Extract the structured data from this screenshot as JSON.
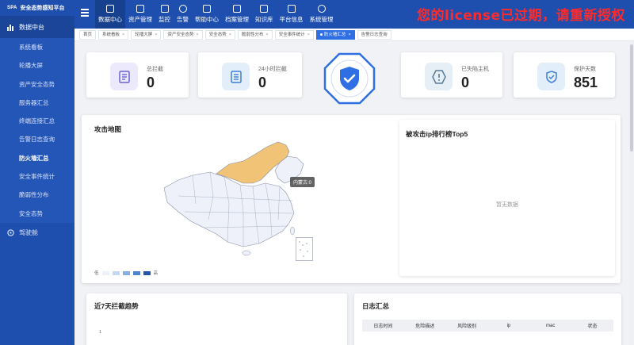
{
  "app": {
    "title": "安全态势感知平台",
    "logo_text": "SPA"
  },
  "license_warning": "您的license已过期，请重新授权",
  "sidebar": {
    "section": "数据中台",
    "items": [
      {
        "label": "系统看板"
      },
      {
        "label": "轮播大屏"
      },
      {
        "label": "资产安全态势"
      },
      {
        "label": "服务器汇总"
      },
      {
        "label": "终端连接汇总"
      },
      {
        "label": "告警日志查询"
      },
      {
        "label": "防火墙汇总"
      },
      {
        "label": "安全事件统计"
      },
      {
        "label": "脆弱性分布"
      },
      {
        "label": "安全态势"
      }
    ],
    "section2": "驾驶舱"
  },
  "topnav": [
    {
      "label": "数据中心",
      "icon": "data-center-icon"
    },
    {
      "label": "资产管理",
      "icon": "asset-icon"
    },
    {
      "label": "监控",
      "icon": "monitor-icon"
    },
    {
      "label": "告警",
      "icon": "alarm-icon"
    },
    {
      "label": "帮助中心",
      "icon": "help-icon"
    },
    {
      "label": "档案管理",
      "icon": "archive-icon"
    },
    {
      "label": "知识库",
      "icon": "knowledge-icon"
    },
    {
      "label": "平台信息",
      "icon": "platform-icon"
    },
    {
      "label": "系统管理",
      "icon": "gear-icon"
    }
  ],
  "tabs": [
    {
      "label": "首页"
    },
    {
      "label": "系统看板"
    },
    {
      "label": "轮播大屏"
    },
    {
      "label": "资产安全态势"
    },
    {
      "label": "安全态势"
    },
    {
      "label": "脆弱性分布"
    },
    {
      "label": "安全事件统计"
    },
    {
      "label": "防火墙汇总"
    },
    {
      "label": "告警日志查询"
    }
  ],
  "stats": [
    {
      "label": "总拦截",
      "value": "0",
      "icon": "document-icon"
    },
    {
      "label": "24小时拦截",
      "value": "0",
      "icon": "document-icon"
    },
    {
      "label": "已失陷主机",
      "value": "0",
      "icon": "warning-icon"
    },
    {
      "label": "保护天数",
      "value": "851",
      "icon": "shield-check-icon"
    }
  ],
  "attack_map": {
    "title": "攻击地图",
    "tooltip": "内蒙古:0",
    "legend_low": "低",
    "legend_high": "高",
    "colors": [
      "#eef0fa",
      "#c6d8f0",
      "#86aee0",
      "#4d83cf",
      "#2456a8"
    ],
    "highlight_color": "#f1c376"
  },
  "top5": {
    "title": "被攻击ip排行榜Top5",
    "empty": "暂无数据"
  },
  "trend": {
    "title": "近7天拦截趋势",
    "axis_tick": "1"
  },
  "logs": {
    "title": "日志汇总",
    "columns": [
      "日志时间",
      "危险描述",
      "风险级别",
      "ip",
      "mac",
      "状态"
    ]
  }
}
